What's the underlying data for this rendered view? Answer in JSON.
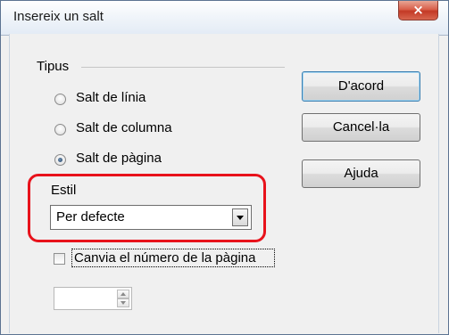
{
  "window": {
    "title": "Insereix un salt",
    "close_icon": "×"
  },
  "type_group": {
    "label": "Tipus",
    "options": [
      {
        "label": "Salt de línia",
        "checked": false
      },
      {
        "label": "Salt de columna",
        "checked": false
      },
      {
        "label": "Salt de pàgina",
        "checked": true
      }
    ]
  },
  "style": {
    "label": "Estil",
    "value": "Per defecte"
  },
  "page_number": {
    "label": "Canvia el número de la pàgina",
    "checked": false,
    "value": ""
  },
  "buttons": {
    "ok": "D'acord",
    "cancel": "Cancel·la",
    "help": "Ajuda"
  },
  "colors": {
    "highlight": "#e8121b",
    "close_button": "#c33a26",
    "default_button_border": "#3c7fb1"
  }
}
